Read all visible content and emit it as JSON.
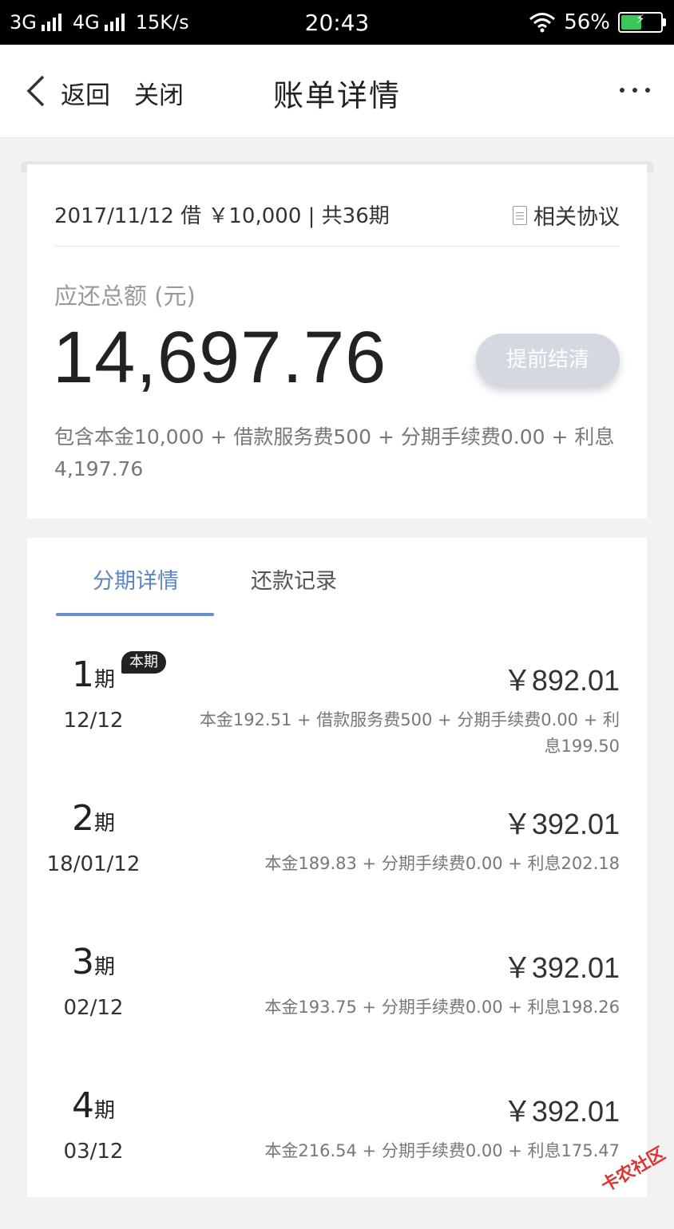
{
  "status_bar": {
    "network1": "3G",
    "network2": "4G",
    "speed": "15K/s",
    "time": "20:43",
    "battery_percent": "56%",
    "battery_level": 0.56
  },
  "nav": {
    "back_label": "返回",
    "close_label": "关闭",
    "title": "账单详情"
  },
  "summary": {
    "loan_info": "2017/11/12 借 ￥10,000 | 共36期",
    "agreement_label": "相关协议",
    "total_label": "应还总额 (元)",
    "total_amount": "14,697.76",
    "prepay_button": "提前结清",
    "breakdown": "包含本金10,000 + 借款服务费500 + 分期手续费0.00 + 利息4,197.76"
  },
  "tabs": {
    "installments": "分期详情",
    "records": "还款记录"
  },
  "installments": [
    {
      "num": "1",
      "unit": "期",
      "badge": "本期",
      "date": "12/12",
      "amount": "￥892.01",
      "detail": "本金192.51 + 借款服务费500 + 分期手续费0.00 + 利息199.50"
    },
    {
      "num": "2",
      "unit": "期",
      "date": "18/01/12",
      "amount": "￥392.01",
      "detail": "本金189.83 + 分期手续费0.00 + 利息202.18"
    },
    {
      "num": "3",
      "unit": "期",
      "date": "02/12",
      "amount": "￥392.01",
      "detail": "本金193.75 + 分期手续费0.00 + 利息198.26"
    },
    {
      "num": "4",
      "unit": "期",
      "date": "03/12",
      "amount": "￥392.01",
      "detail": "本金216.54 + 分期手续费0.00 + 利息175.47"
    }
  ],
  "watermark": "卡农社区"
}
